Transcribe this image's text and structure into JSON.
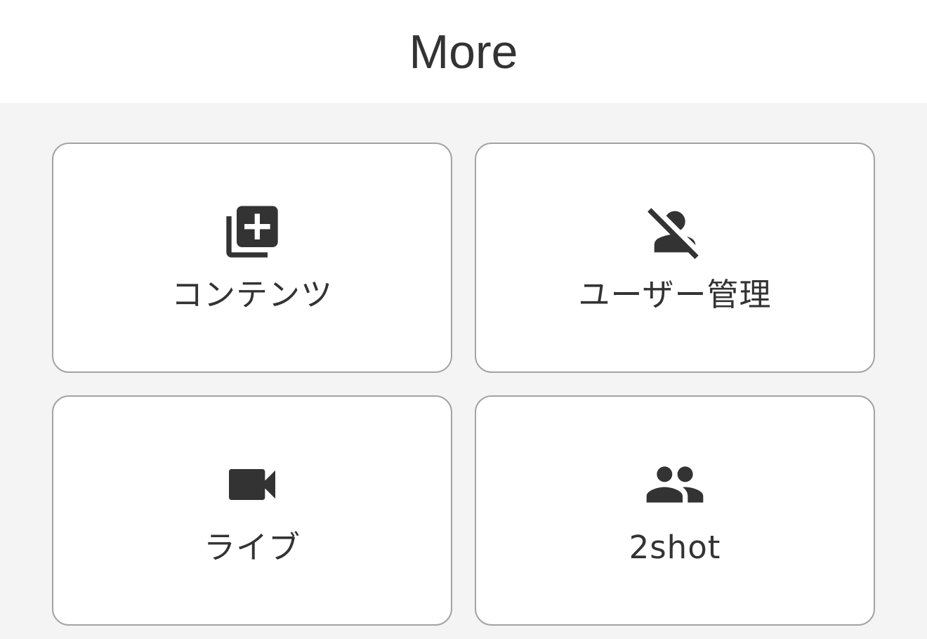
{
  "header": {
    "title": "More"
  },
  "menu": {
    "items": [
      {
        "id": "contents",
        "label": "コンテンツ",
        "icon": "library-add-icon"
      },
      {
        "id": "user-management",
        "label": "ユーザー管理",
        "icon": "person-off-icon"
      },
      {
        "id": "live",
        "label": "ライブ",
        "icon": "videocam-icon"
      },
      {
        "id": "2shot",
        "label": "2shot",
        "icon": "people-icon"
      }
    ]
  },
  "colors": {
    "background": "#f4f4f4",
    "header_background": "#ffffff",
    "tile_background": "#ffffff",
    "tile_border": "#a3a3a3",
    "text": "#333333"
  }
}
